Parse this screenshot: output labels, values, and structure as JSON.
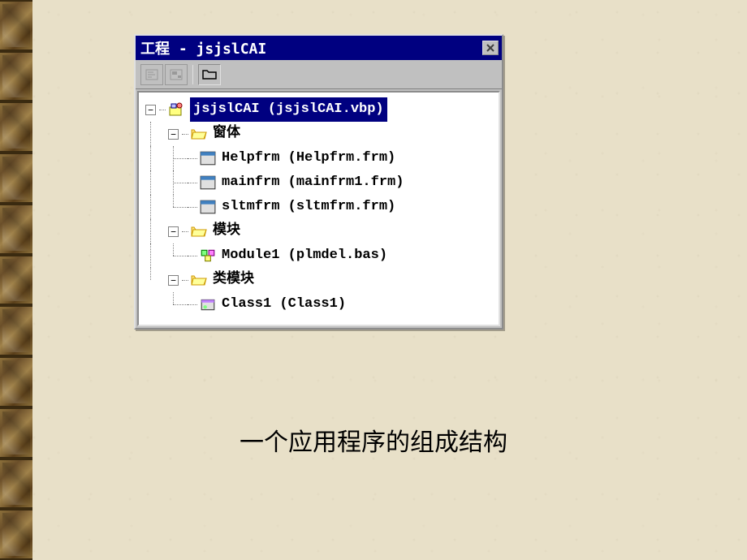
{
  "window": {
    "title": "工程 - jsjslCAI",
    "close_label": "×"
  },
  "tree": {
    "root": {
      "label": "jsjslCAI (jsjslCAI.vbp)",
      "expanded": true,
      "selected": true
    },
    "folders": [
      {
        "label": "窗体",
        "expanded": true,
        "items": [
          {
            "label": "Helpfrm (Helpfrm.frm)"
          },
          {
            "label": "mainfrm (mainfrm1.frm)"
          },
          {
            "label": "sltmfrm (sltmfrm.frm)"
          }
        ]
      },
      {
        "label": "模块",
        "expanded": true,
        "items": [
          {
            "label": "Module1 (plmdel.bas)"
          }
        ]
      },
      {
        "label": "类模块",
        "expanded": true,
        "items": [
          {
            "label": "Class1 (Class1)"
          }
        ]
      }
    ]
  },
  "caption": "一个应用程序的组成结构"
}
